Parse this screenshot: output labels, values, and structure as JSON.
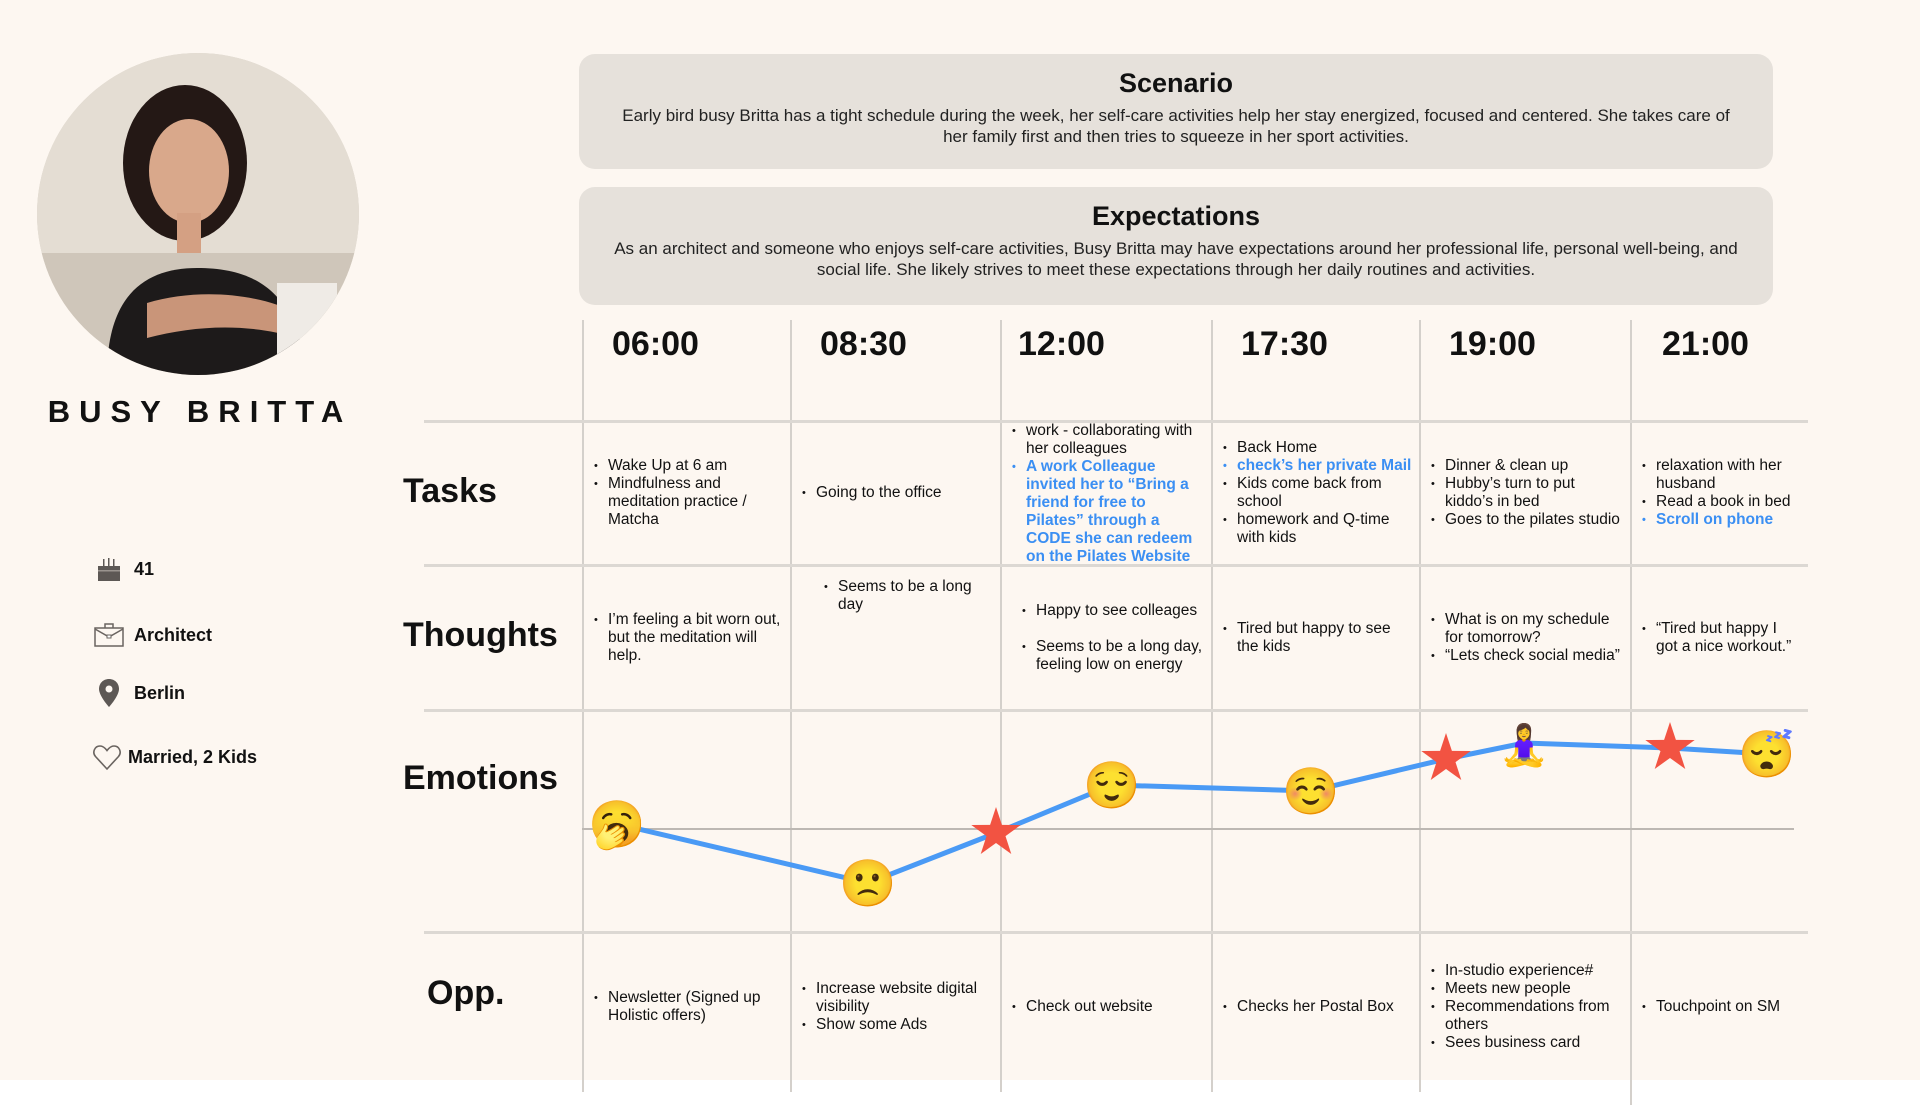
{
  "persona": {
    "name": "BUSY BRITTA",
    "age": "41",
    "job": "Architect",
    "city": "Berlin",
    "status": "Married, 2 Kids"
  },
  "scenario": {
    "title": "Scenario",
    "text": "Early bird busy Britta has a tight schedule during the week, her self-care activities help her stay energized, focused and centered. She takes care of her family first and then tries to squeeze in her sport activities."
  },
  "expectations": {
    "title": "Expectations",
    "text": "As an architect and someone who enjoys self-care activities, Busy Britta may have expectations around her professional life, personal well-being, and social life. She likely strives to meet these expectations through her daily routines and activities."
  },
  "times": [
    "06:00",
    "08:30",
    "12:00",
    "17:30",
    "19:00",
    "21:00"
  ],
  "row_labels": {
    "tasks": "Tasks",
    "thoughts": "Thoughts",
    "emotions": "Emotions",
    "opp": "Opp."
  },
  "tasks": [
    [
      {
        "t": "Wake Up at 6 am"
      },
      {
        "t": "Mindfulness and meditation practice / Matcha"
      }
    ],
    [
      {
        "t": "Going to the office"
      }
    ],
    [
      {
        "t": "work - collaborating with her colleagues"
      },
      {
        "t": "A work Colleague invited her to “Bring a friend for free to Pilates” through a CODE she can redeem on the Pilates Website",
        "highlight": true
      }
    ],
    [
      {
        "t": "Back Home"
      },
      {
        "t": "check’s her private Mail",
        "highlight": true
      },
      {
        "t": "Kids come back from school"
      },
      {
        "t": "homework and Q-time with kids"
      }
    ],
    [
      {
        "t": "Dinner & clean up"
      },
      {
        "t": "Hubby’s turn to put kiddo’s in bed"
      },
      {
        "t": "Goes to the pilates studio"
      }
    ],
    [
      {
        "t": "relaxation with her husband"
      },
      {
        "t": "Read a book in bed"
      },
      {
        "t": "Scroll on phone",
        "highlight": true
      }
    ]
  ],
  "thoughts": [
    [
      {
        "t": "I’m feeling a bit worn out, but the meditation will help."
      }
    ],
    [
      {
        "t": "Seems to be a long day"
      }
    ],
    [
      {
        "t": "Happy to see colleages"
      },
      {
        "t": "Seems to be a long day, feeling low on energy",
        "gap": true
      }
    ],
    [
      {
        "t": "Tired but happy to see the kids"
      }
    ],
    [
      {
        "t": "What is on my schedule for tomorrow?"
      },
      {
        "t": "“Lets check social media”"
      }
    ],
    [
      {
        "t": "“Tired but happy I got a nice workout.”"
      }
    ]
  ],
  "opportunities": [
    [
      {
        "t": "Newsletter (Signed up Holistic offers)"
      }
    ],
    [
      {
        "t": "Increase website digital visibility"
      },
      {
        "t": "Show some Ads"
      }
    ],
    [
      {
        "t": "Check out website"
      }
    ],
    [
      {
        "t": "Checks her Postal Box"
      }
    ],
    [
      {
        "t": "In-studio experience#"
      },
      {
        "t": "Meets new people"
      },
      {
        "t": "Recommendations from others"
      },
      {
        "t": "Sees business card"
      }
    ],
    [
      {
        "t": "Touchpoint on SM"
      }
    ]
  ],
  "emotions": {
    "line_color": "#4a9af5",
    "star_color": "#f25342",
    "points": [
      {
        "marker": "yawning-face",
        "glyph": "🥱",
        "level": 0.05
      },
      {
        "marker": "slightly-frowning-face",
        "glyph": "🙁",
        "level": -0.54
      },
      {
        "marker": "touchpoint-star",
        "glyph": "★",
        "level": -0.04
      },
      {
        "marker": "relieved-face",
        "glyph": "😌",
        "level": 0.44
      },
      {
        "marker": "smiling-face",
        "glyph": "☺️",
        "level": 0.38
      },
      {
        "marker": "touchpoint-star",
        "glyph": "★",
        "level": 0.7
      },
      {
        "marker": "person-in-lotus-position",
        "glyph": "🧘‍♀️",
        "level": 0.86
      },
      {
        "marker": "touchpoint-star",
        "glyph": "★",
        "level": 0.81
      },
      {
        "marker": "sleeping-face",
        "glyph": "😴",
        "level": 0.75
      }
    ]
  },
  "colors": {
    "background": "#fdf7f1",
    "card": "#e6e1db",
    "highlight_text": "#3b8ff3"
  }
}
